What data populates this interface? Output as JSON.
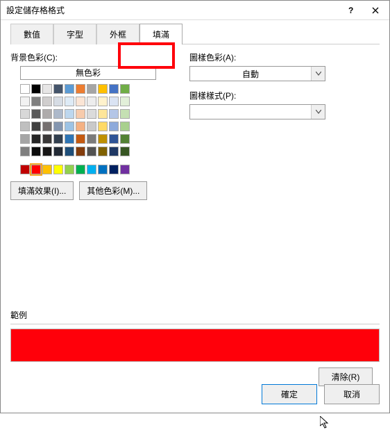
{
  "title": "設定儲存格格式",
  "tabs": {
    "number": "數值",
    "font": "字型",
    "border": "外框",
    "fill": "填滿"
  },
  "fill": {
    "bgcolor_label": "背景色彩(C):",
    "no_color": "無色彩",
    "effects_btn": "填滿效果(I)...",
    "more_colors_btn": "其他色彩(M)...",
    "pattern_color_label": "圖樣色彩(A):",
    "pattern_color_value": "自動",
    "pattern_style_label": "圖樣樣式(P):",
    "pattern_style_value": ""
  },
  "sample": {
    "label": "範例",
    "color": "#ff000a"
  },
  "buttons": {
    "clear": "清除(R)",
    "ok": "確定",
    "cancel": "取消"
  },
  "palette_main": [
    [
      "#ffffff",
      "#000000",
      "#e7e6e6",
      "#44546a",
      "#5b9bd5",
      "#ed7d31",
      "#a5a5a5",
      "#ffc000",
      "#4472c4",
      "#70ad47"
    ],
    [
      "#f2f2f2",
      "#808080",
      "#d0cece",
      "#d6dce4",
      "#deebf6",
      "#fbe5d5",
      "#ededed",
      "#fff2cc",
      "#dae3f3",
      "#e2efd9"
    ],
    [
      "#d8d8d8",
      "#595959",
      "#aeabab",
      "#adb9ca",
      "#bdd7ee",
      "#f7cbac",
      "#dbdbdb",
      "#fee599",
      "#b4c6e7",
      "#c5e0b3"
    ],
    [
      "#bfbfbf",
      "#3f3f3f",
      "#757070",
      "#8496b0",
      "#9cc3e5",
      "#f4b183",
      "#c9c9c9",
      "#ffd965",
      "#8eaadb",
      "#a8d08d"
    ],
    [
      "#a5a5a5",
      "#262626",
      "#3a3838",
      "#323f4f",
      "#2e75b5",
      "#c55a11",
      "#7b7b7b",
      "#bf9000",
      "#2f5496",
      "#538135"
    ],
    [
      "#7f7f7f",
      "#0c0c0c",
      "#171616",
      "#222a35",
      "#1e4e79",
      "#833c0b",
      "#525252",
      "#7f6000",
      "#1f3864",
      "#375623"
    ]
  ],
  "palette_std": [
    "#c00000",
    "#ff0000",
    "#ffc000",
    "#ffff00",
    "#92d050",
    "#00b050",
    "#00b0f0",
    "#0070c0",
    "#002060",
    "#7030a0"
  ],
  "selected_swatch": [
    6,
    1
  ]
}
